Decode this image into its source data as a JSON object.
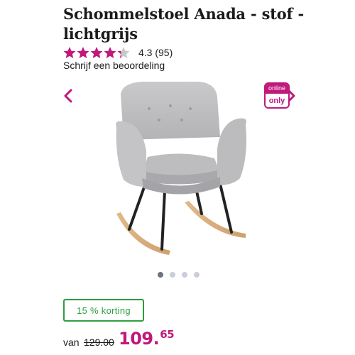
{
  "product": {
    "title": "Schommelstoel Anada - stof - lichtgrijs",
    "rating_value": 4.3,
    "rating_max": 5,
    "rating_text": "4.3 (95)",
    "review_link": "Schrijf een beoordeling"
  },
  "gallery": {
    "badge_top": "online",
    "badge_bottom": "only",
    "image_count": 4,
    "active_index": 0,
    "prev_icon": "chevron-left-icon",
    "next_icon": "chevron-right-icon",
    "image_subject": "chair-image"
  },
  "pricing": {
    "discount_label": "15 % korting",
    "van_label": "van",
    "old_price": "129.00",
    "price_main": "109.",
    "price_decimals": "65"
  },
  "colors": {
    "accent": "#c0187b",
    "discount_green": "#2e9e3e",
    "star_empty": "#c8c8c8"
  }
}
